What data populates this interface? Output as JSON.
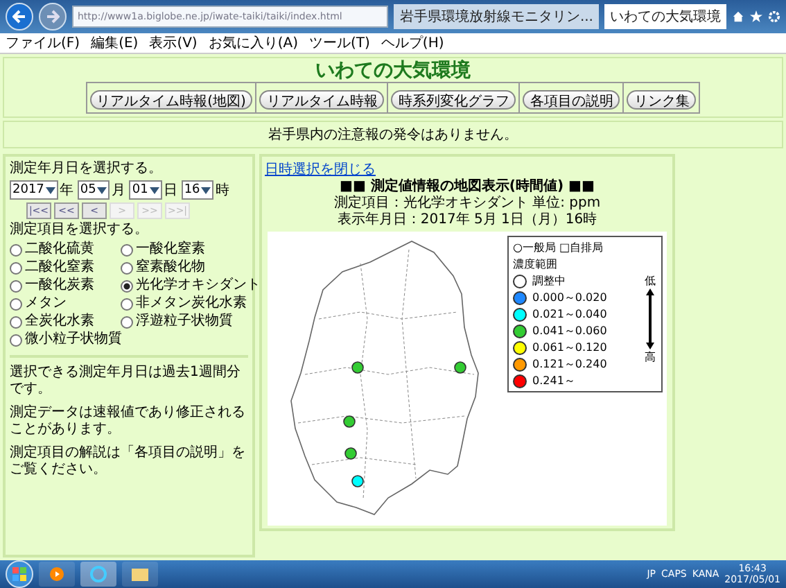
{
  "browser": {
    "address": "http://www1a.biglobe.ne.jp/iwate-taiki/taiki/index.html",
    "tabs": [
      {
        "title": "岩手県環境放射線モニタリン...",
        "selected": false
      },
      {
        "title": "いわての大気環境",
        "selected": true
      }
    ],
    "menu": [
      "ファイル(F)",
      "編集(E)",
      "表示(V)",
      "お気に入り(A)",
      "ツール(T)",
      "ヘルプ(H)"
    ]
  },
  "header": {
    "title": "いわての大気環境",
    "nav_buttons": [
      "リアルタイム時報(地図)",
      "リアルタイム時報",
      "時系列変化グラフ",
      "各項目の説明",
      "リンク集"
    ]
  },
  "notice": "岩手県内の注意報の発令はありません。",
  "date_panel": {
    "date_label": "測定年月日を選択する。",
    "selects": [
      {
        "value": "2017",
        "unit": "年"
      },
      {
        "value": "05",
        "unit": "月"
      },
      {
        "value": "01",
        "unit": "日"
      },
      {
        "value": "16",
        "unit": "時"
      }
    ],
    "step_buttons": [
      {
        "label": "|<<",
        "disabled": false
      },
      {
        "label": "<<",
        "disabled": false
      },
      {
        "label": "<",
        "disabled": false
      },
      {
        "label": ">",
        "disabled": true
      },
      {
        "label": ">>",
        "disabled": true
      },
      {
        "label": ">>|",
        "disabled": true
      }
    ],
    "item_label": "測定項目を選択する。",
    "items": [
      {
        "label": "二酸化硫黄",
        "selected": false
      },
      {
        "label": "一酸化窒素",
        "selected": false
      },
      {
        "label": "二酸化窒素",
        "selected": false
      },
      {
        "label": "窒素酸化物",
        "selected": false
      },
      {
        "label": "一酸化炭素",
        "selected": false
      },
      {
        "label": "光化学オキシダント",
        "selected": true
      },
      {
        "label": "メタン",
        "selected": false
      },
      {
        "label": "非メタン炭化水素",
        "selected": false
      },
      {
        "label": "全炭化水素",
        "selected": false
      },
      {
        "label": "浮遊粒子状物質",
        "selected": false
      },
      {
        "label": "微小粒子状物質",
        "selected": false
      }
    ],
    "notes": [
      "選択できる測定年月日は過去1週間分です。",
      "測定データは速報値であり修正されることがあります。",
      "測定項目の解説は「各項目の説明」をご覧ください。"
    ]
  },
  "map_panel": {
    "close_link": "日時選択を閉じる",
    "heading": "■■ 測定値情報の地図表示(時間値) ■■",
    "item_line": "測定項目：光化学オキシダント 単位: ppm",
    "date_line": "表示年月日：2017年 5月 1日（月）16時",
    "legend": {
      "station_types": "○一般局 □自排局",
      "range_title": "濃度範囲",
      "ranges": [
        {
          "label": "調整中",
          "color": "#ffffff"
        },
        {
          "label": "0.000～0.020",
          "color": "#1e88ff"
        },
        {
          "label": "0.021～0.040",
          "color": "#00ffff"
        },
        {
          "label": "0.041～0.060",
          "color": "#33cc33"
        },
        {
          "label": "0.061～0.120",
          "color": "#ffff00"
        },
        {
          "label": "0.121～0.240",
          "color": "#ff9900"
        },
        {
          "label": "0.241～",
          "color": "#ff0000"
        }
      ],
      "low": "低",
      "high": "高"
    },
    "stations": [
      {
        "color": "#33cc33"
      },
      {
        "color": "#33cc33"
      },
      {
        "color": "#33cc33"
      },
      {
        "color": "#33cc33"
      },
      {
        "color": "#00ffff"
      }
    ]
  },
  "taskbar": {
    "language": "JP",
    "caps": "CAPS",
    "kana": "KANA",
    "time": "16:43",
    "date": "2017/05/01"
  }
}
